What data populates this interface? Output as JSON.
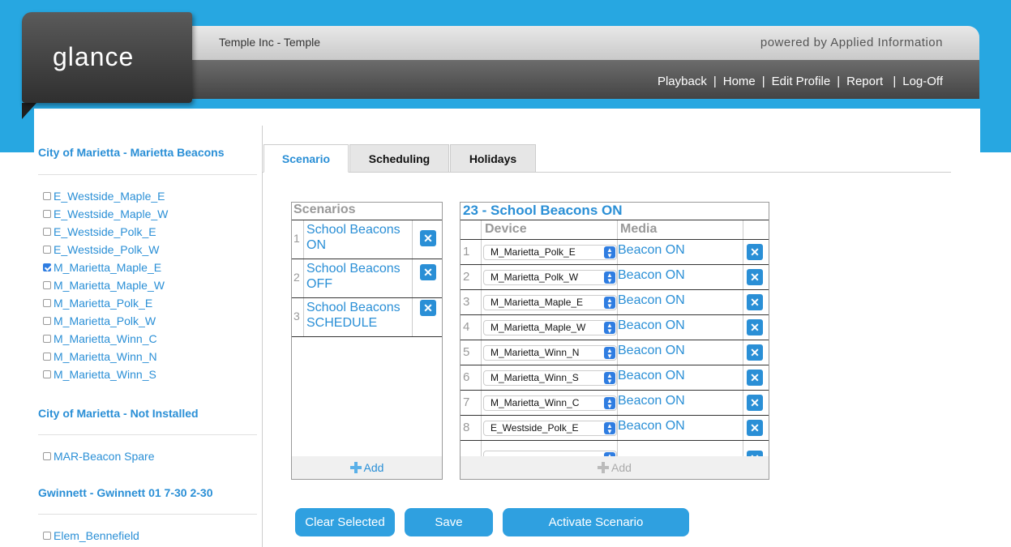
{
  "header": {
    "logo_text": "glance",
    "company": "Temple Inc - Temple",
    "powered_by": "powered by Applied Information",
    "nav": [
      "Playback",
      "Home",
      "Edit Profile",
      "Report",
      "Log-Off"
    ]
  },
  "sidebar": {
    "groups": [
      {
        "title": "City of Marietta - Marietta Beacons",
        "items": [
          {
            "label": "E_Westside_Maple_E",
            "checked": false
          },
          {
            "label": "E_Westside_Maple_W",
            "checked": false
          },
          {
            "label": "E_Westside_Polk_E",
            "checked": false
          },
          {
            "label": "E_Westside_Polk_W",
            "checked": false
          },
          {
            "label": "M_Marietta_Maple_E",
            "checked": true
          },
          {
            "label": "M_Marietta_Maple_W",
            "checked": false
          },
          {
            "label": "M_Marietta_Polk_E",
            "checked": false
          },
          {
            "label": "M_Marietta_Polk_W",
            "checked": false
          },
          {
            "label": "M_Marietta_Winn_C",
            "checked": false
          },
          {
            "label": "M_Marietta_Winn_N",
            "checked": false
          },
          {
            "label": "M_Marietta_Winn_S",
            "checked": false
          }
        ]
      },
      {
        "title": "City of Marietta - Not Installed",
        "items": [
          {
            "label": "MAR-Beacon Spare",
            "checked": false
          }
        ]
      },
      {
        "title": "Gwinnett - Gwinnett 01 7-30 2-30",
        "items": [
          {
            "label": "Elem_Bennefield",
            "checked": false
          }
        ]
      }
    ]
  },
  "tabs": [
    "Scenario",
    "Scheduling",
    "Holidays"
  ],
  "scenarios": {
    "title": "Scenarios",
    "rows": [
      {
        "num": "1",
        "name": "School Beacons ON"
      },
      {
        "num": "2",
        "name": "School Beacons OFF"
      },
      {
        "num": "3",
        "name": "School Beacons SCHEDULE"
      }
    ],
    "add_label": "Add"
  },
  "devices": {
    "title": "23 - School Beacons ON",
    "col_device": "Device",
    "col_media": "Media",
    "rows": [
      {
        "num": "1",
        "device": "M_Marietta_Polk_E",
        "media": "Beacon ON"
      },
      {
        "num": "2",
        "device": "M_Marietta_Polk_W",
        "media": "Beacon ON"
      },
      {
        "num": "3",
        "device": "M_Marietta_Maple_E",
        "media": "Beacon ON"
      },
      {
        "num": "4",
        "device": "M_Marietta_Maple_W",
        "media": "Beacon ON"
      },
      {
        "num": "5",
        "device": "M_Marietta_Winn_N",
        "media": "Beacon ON"
      },
      {
        "num": "6",
        "device": "M_Marietta_Winn_S",
        "media": "Beacon ON"
      },
      {
        "num": "7",
        "device": "M_Marietta_Winn_C",
        "media": "Beacon ON"
      },
      {
        "num": "8",
        "device": "E_Westside_Polk_E",
        "media": "Beacon ON"
      }
    ],
    "add_label": "Add"
  },
  "buttons": {
    "clear": "Clear Selected",
    "save": "Save",
    "activate": "Activate Scenario"
  },
  "icons": {
    "remove": "close-icon",
    "add": "plus-icon",
    "select_arrow": "updown-arrow-icon",
    "checkbox": "checkbox"
  },
  "colors": {
    "accent": "#2a8fd6",
    "band": "#27a7e1",
    "button": "#2fa0e0"
  }
}
